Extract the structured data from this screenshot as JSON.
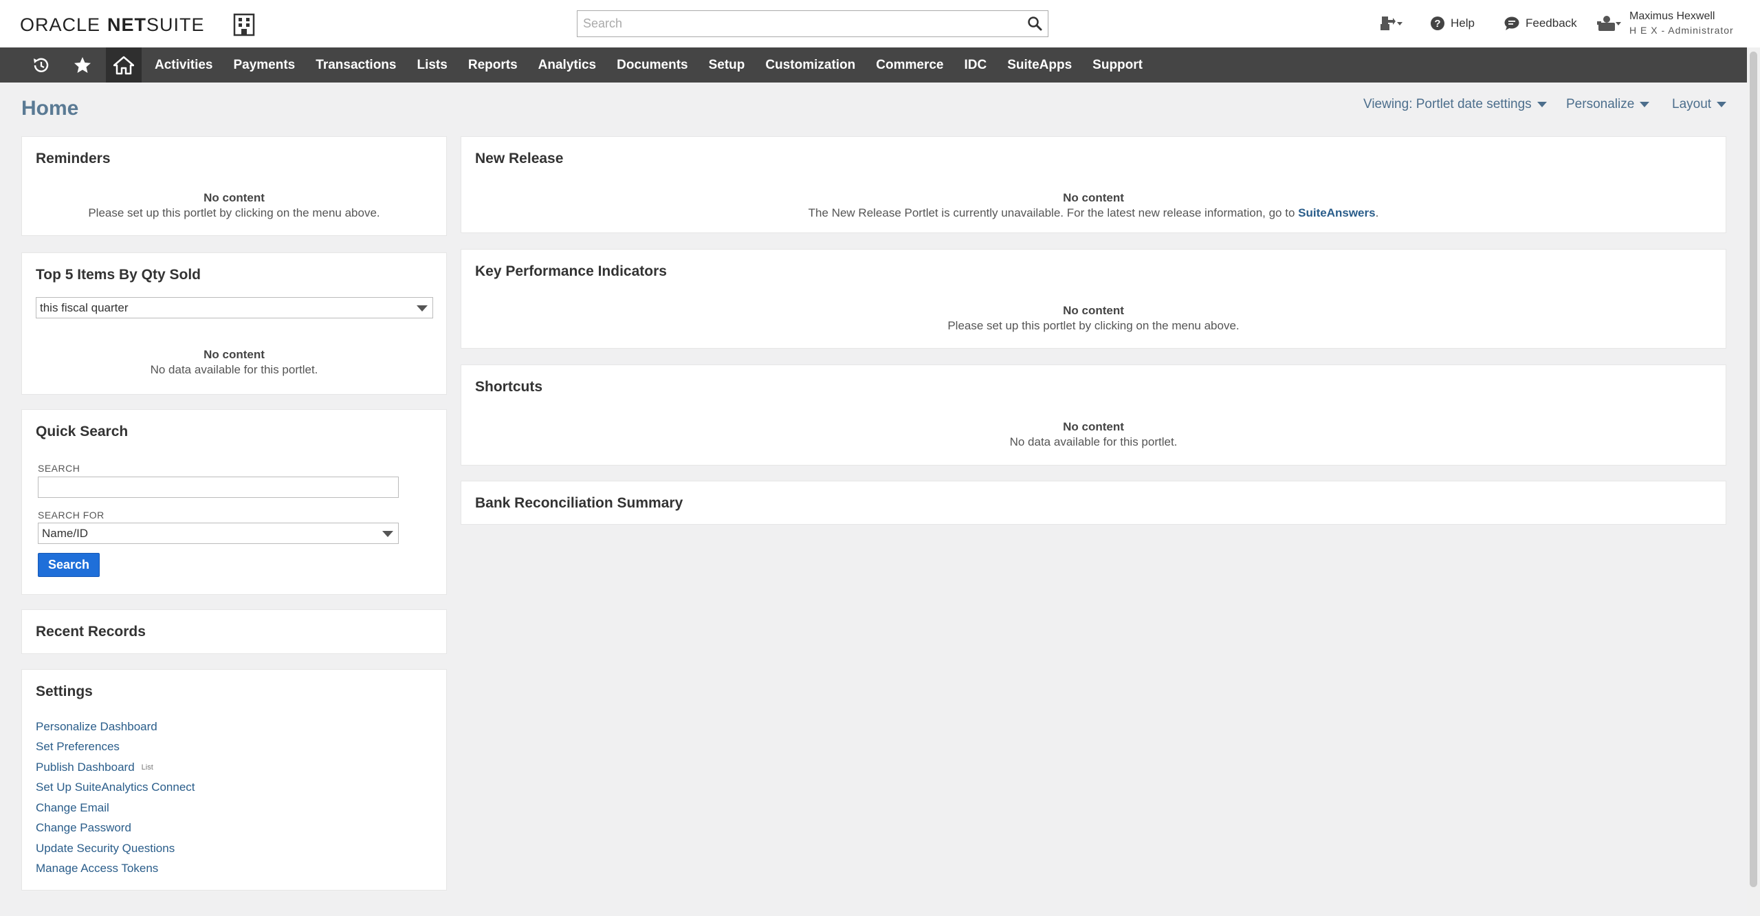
{
  "header": {
    "logo_part1": "ORACLE",
    "logo_part2": "NET",
    "logo_part3": "SUITE",
    "search_placeholder": "Search",
    "help_label": "Help",
    "feedback_label": "Feedback",
    "user_name": "Maximus Hexwell",
    "user_role": "H E X - Administrator"
  },
  "nav": {
    "items": [
      "Activities",
      "Payments",
      "Transactions",
      "Lists",
      "Reports",
      "Analytics",
      "Documents",
      "Setup",
      "Customization",
      "Commerce",
      "IDC",
      "SuiteApps",
      "Support"
    ]
  },
  "page": {
    "title": "Home",
    "viewing": "Viewing: Portlet date settings",
    "personalize": "Personalize",
    "layout": "Layout"
  },
  "reminders": {
    "title": "Reminders",
    "no_content": "No content",
    "message": "Please set up this portlet by clicking on the menu above."
  },
  "top_items": {
    "title": "Top 5 Items By Qty Sold",
    "period": "this fiscal quarter",
    "no_content": "No content",
    "message": "No data available for this portlet."
  },
  "quick_search": {
    "title": "Quick Search",
    "search_label": "SEARCH",
    "search_value": "",
    "search_for_label": "SEARCH FOR",
    "search_for_value": "Name/ID",
    "button": "Search"
  },
  "recent_records": {
    "title": "Recent Records"
  },
  "settings": {
    "title": "Settings",
    "links": [
      "Personalize Dashboard",
      "Set Preferences",
      "Publish Dashboard",
      "Set Up SuiteAnalytics Connect",
      "Change Email",
      "Change Password",
      "Update Security Questions",
      "Manage Access Tokens"
    ],
    "publish_tag": "List"
  },
  "new_release": {
    "title": "New Release",
    "no_content": "No content",
    "message": "The New Release Portlet is currently unavailable. For the latest new release information, go to",
    "link": "SuiteAnswers",
    "suffix": "."
  },
  "kpi": {
    "title": "Key Performance Indicators",
    "no_content": "No content",
    "message": "Please set up this portlet by clicking on the menu above."
  },
  "shortcuts": {
    "title": "Shortcuts",
    "no_content": "No content",
    "message": "No data available for this portlet."
  },
  "bank_rec": {
    "title": "Bank Reconciliation Summary"
  },
  "colors": {
    "nav_bg": "#454545",
    "accent_blue": "#1f6fd9",
    "link_blue": "#2a5d8a",
    "title_blue": "#5a7a94"
  },
  "icons": [
    "company-logo-icon",
    "search-icon",
    "switch-role-icon",
    "help-icon",
    "feedback-icon",
    "user-roles-icon",
    "recent-history-icon",
    "favorites-star-icon",
    "home-icon"
  ]
}
